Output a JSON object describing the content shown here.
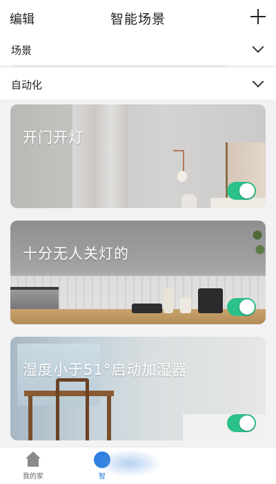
{
  "header": {
    "edit_label": "编辑",
    "title": "智能场景",
    "add_icon": "plus-icon"
  },
  "sections": {
    "scene": {
      "label": "场景",
      "icon": "chevron-down-icon"
    },
    "automation": {
      "label": "自动化",
      "icon": "chevron-down-icon"
    }
  },
  "automations": [
    {
      "name": "开门开灯",
      "enabled": true
    },
    {
      "name": "十分无人关灯的",
      "enabled": true
    },
    {
      "name": "湿度小于51°启动加湿器",
      "enabled": true
    }
  ],
  "tabbar": {
    "items": [
      {
        "label": "我的家",
        "icon": "home-icon",
        "active": false
      },
      {
        "label": "智",
        "icon": "scene-icon",
        "active": true
      }
    ]
  },
  "colors": {
    "toggle_on": "#2cc08a",
    "accent": "#2f7fe0"
  }
}
